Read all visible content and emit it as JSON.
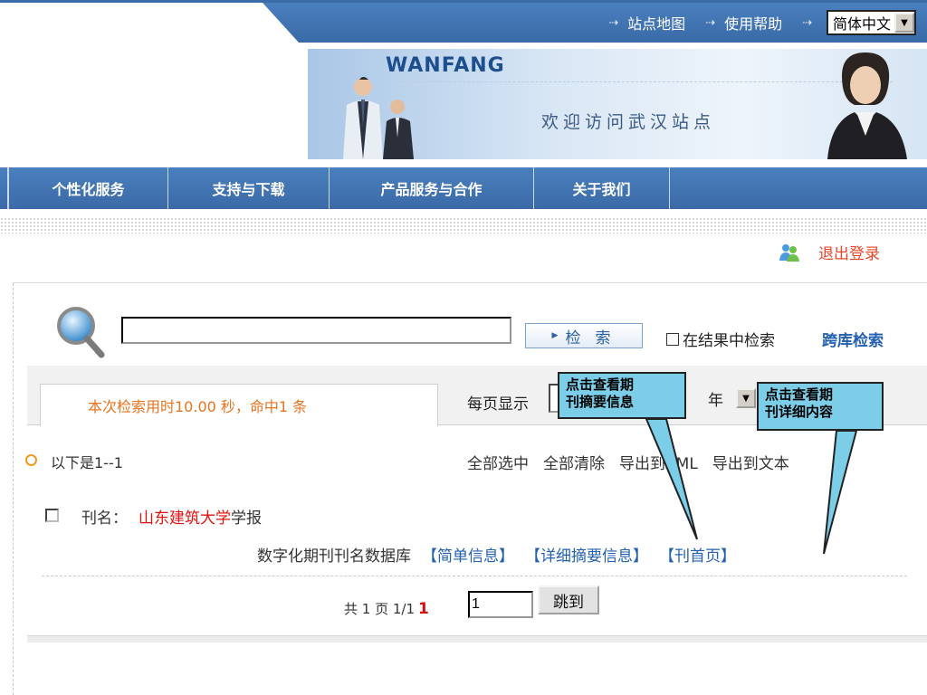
{
  "topbar": {
    "links": [
      {
        "label": "站点地图",
        "icon": "arrow-icon"
      },
      {
        "label": "使用帮助",
        "icon": "arrow-icon"
      }
    ],
    "language": "简体中文"
  },
  "banner": {
    "brand": "WANFANG",
    "welcome": "欢迎访问武汉站点"
  },
  "nav": {
    "items": [
      "个性化服务",
      "支持与下载",
      "产品服务与合作",
      "关于我们"
    ]
  },
  "user": {
    "logout_label": "退出登录"
  },
  "search": {
    "query": "",
    "button_label": "检索",
    "in_results_label": "在结果中检索",
    "cross_db_label": "跨库检索"
  },
  "results": {
    "summary": "本次检索用时10.00 秒，命中1 条",
    "per_page_label": "每页显示",
    "year_label": "年",
    "range_label": "以下是1--1",
    "actions": [
      "全部选中",
      "全部清除",
      "导出到XML",
      "导出到文本"
    ],
    "items": [
      {
        "label": "刊名：",
        "title_highlight": "山东建筑大学",
        "title_rest": "学报",
        "database": "数字化期刊刊名数据库",
        "links": [
          "【简单信息】",
          "【详细摘要信息】",
          "【刊首页】"
        ]
      }
    ]
  },
  "pager": {
    "summary": "共 1 页 1/1",
    "current": "1",
    "input_value": "1",
    "jump_label": "跳到"
  },
  "callouts": [
    "点击查看期\n刊摘要信息",
    "点击查看期\n刊详细内容"
  ]
}
